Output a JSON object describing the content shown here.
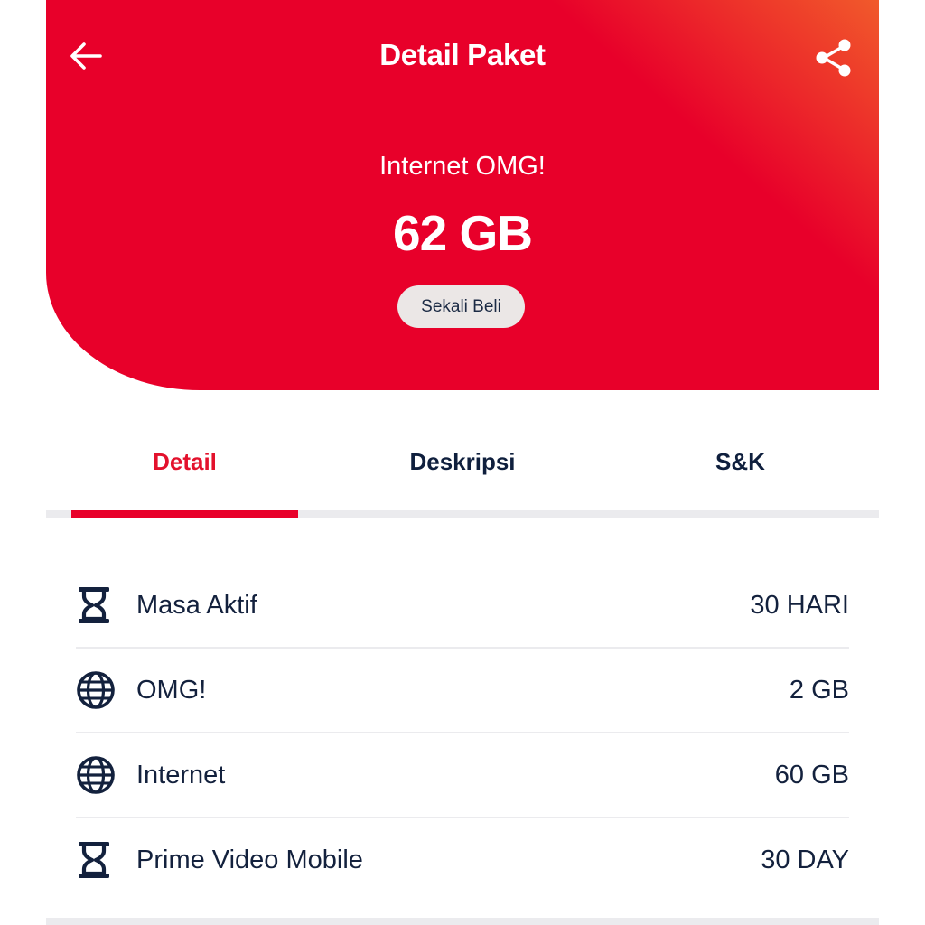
{
  "header": {
    "title": "Detail Paket",
    "back_icon": "arrow-left-icon",
    "share_icon": "share-icon"
  },
  "package": {
    "name": "Internet OMG!",
    "size": "62 GB",
    "purchase_type": "Sekali Beli"
  },
  "tabs": [
    {
      "label": "Detail",
      "active": true
    },
    {
      "label": "Deskripsi",
      "active": false
    },
    {
      "label": "S&K",
      "active": false
    }
  ],
  "details": [
    {
      "icon": "hourglass-icon",
      "label": "Masa Aktif",
      "value": "30 HARI"
    },
    {
      "icon": "globe-icon",
      "label": "OMG!",
      "value": "2 GB"
    },
    {
      "icon": "globe-icon",
      "label": "Internet",
      "value": "60 GB"
    },
    {
      "icon": "hourglass-icon",
      "label": "Prime Video Mobile",
      "value": "30 DAY"
    }
  ],
  "colors": {
    "brand_red": "#e8002a",
    "gradient_orange": "#f15a2b",
    "text_dark": "#13213d",
    "badge_bg": "#ebe7e6",
    "divider": "#ebebee"
  }
}
